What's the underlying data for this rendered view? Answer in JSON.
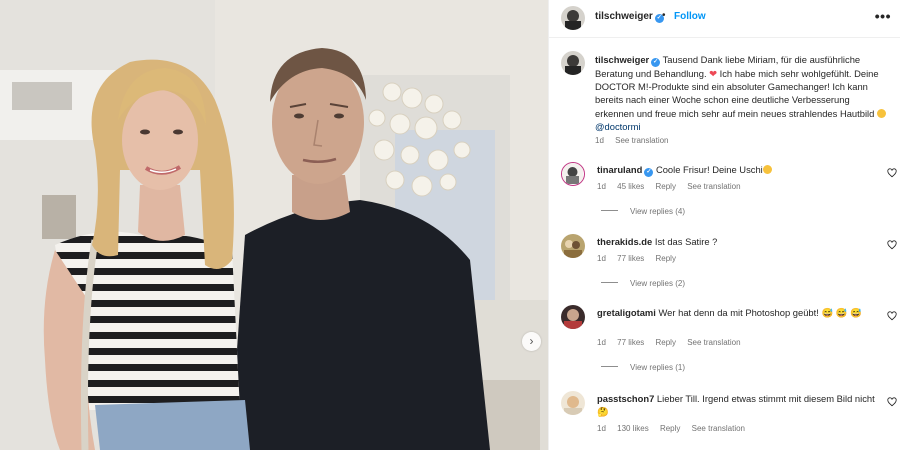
{
  "post": {
    "username": "tilschweiger",
    "follow_label": "Follow",
    "dot": "•",
    "more": "•••"
  },
  "caption": {
    "username": "tilschweiger",
    "text_1": "Tausend Dank liebe Miriam, für die ausführliche Beratung und Behandlung.",
    "text_2": "Ich habe mich sehr wohlgefühlt. Deine DOCTOR M!-Produkte sind ein absoluter Gamechanger! Ich kann bereits nach einer Woche schon eine deutliche Verbesserung erkennen und freue mich sehr auf mein neues strahlendes Hautbild",
    "mention": "@doctormi",
    "time": "1d",
    "translate": "See translation"
  },
  "comments": [
    {
      "username": "tinaruland",
      "verified": true,
      "text": "Coole Frisur! Deine Uschi",
      "emoji": "heart-eyes",
      "time": "1d",
      "likes": "45 likes",
      "reply": "Reply",
      "translate": "See translation",
      "view_replies": "View replies (4)"
    },
    {
      "username": "therakids.de",
      "verified": false,
      "text": "Ist das Satire ?",
      "emoji": "",
      "time": "1d",
      "likes": "77 likes",
      "reply": "Reply",
      "translate": "",
      "view_replies": "View replies (2)"
    },
    {
      "username": "gretaligotami",
      "verified": false,
      "text": "Wer hat denn da mit Photoshop geübt!",
      "emoji": "grin-sweat x3",
      "time": "1d",
      "likes": "77 likes",
      "reply": "Reply",
      "translate": "See translation",
      "view_replies": "View replies (1)"
    },
    {
      "username": "passtschon7",
      "verified": false,
      "text": "Lieber Till. Irgend etwas stimmt mit diesem Bild nicht",
      "emoji": "thinking",
      "time": "1d",
      "likes": "130 likes",
      "reply": "Reply",
      "translate": "See translation",
      "view_replies": ""
    }
  ],
  "icons": {
    "verified": "verified-badge-icon",
    "like": "heart-outline-icon",
    "next": "chevron-right-icon",
    "more": "more-options-icon",
    "red_heart": "red-heart-emoji",
    "heart_eyes": "heart-eyes-emoji"
  },
  "colors": {
    "link_blue": "#0095f6",
    "verified_blue": "#3897f0",
    "text": "#262626",
    "muted": "#737373",
    "mention": "#00376b"
  }
}
